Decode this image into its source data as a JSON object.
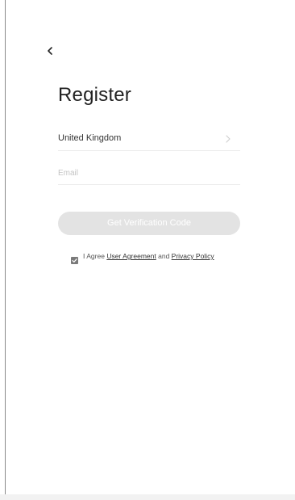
{
  "header": {
    "back_icon": "chevron-left-icon",
    "title": "Register"
  },
  "form": {
    "country": {
      "value": "United Kingdom",
      "chevron_icon": "chevron-right-icon"
    },
    "email": {
      "placeholder": "Email",
      "value": ""
    },
    "get_code_button": "Get Verification Code"
  },
  "agreement": {
    "checked": true,
    "prefix": "I Agree",
    "user_agreement_link": "User Agreement",
    "conjunction": "and",
    "privacy_policy_link": "Privacy Policy"
  },
  "colors": {
    "button_disabled_bg": "#e3e3e3",
    "title_text": "#222222",
    "checkbox_fill": "#7a7a7a"
  }
}
